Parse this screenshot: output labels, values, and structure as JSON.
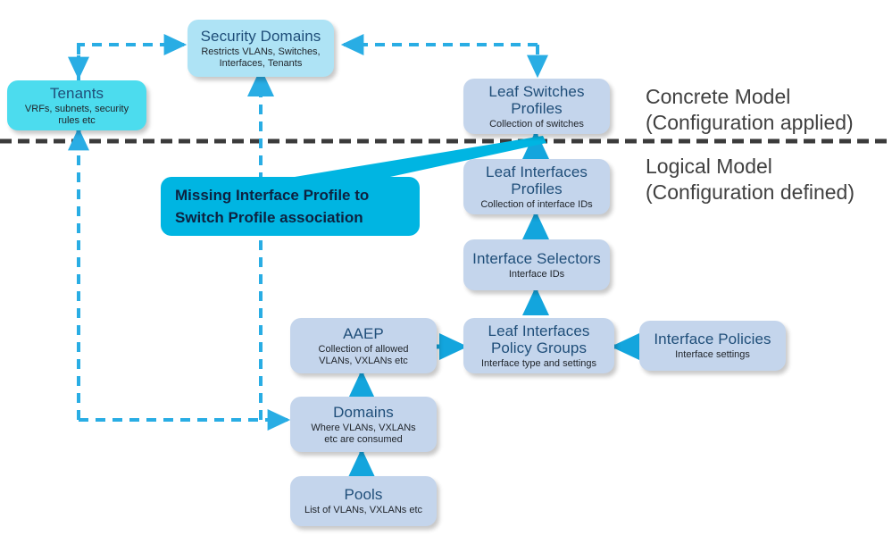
{
  "diagram": {
    "title_hidden": "ACI Policy Model Relationships",
    "colors": {
      "logical_box": "#c4d5ec",
      "concrete_box": "#aee3f5",
      "tenant_box": "#4cdcee",
      "callout": "#00b5e2",
      "arrow": "#29ade4",
      "divider": "#3b3b3b",
      "title_text": "#1f4e79",
      "side_label_text": "#404040"
    }
  },
  "nodes": {
    "security_domains": {
      "title": "Security Domains",
      "subtitle": "Restricts VLANs, Switches,\nInterfaces, Tenants"
    },
    "tenants": {
      "title": "Tenants",
      "subtitle": "VRFs, subnets, security\nrules etc"
    },
    "leaf_switches_profiles": {
      "title": "Leaf Switches\nProfiles",
      "subtitle": "Collection of switches"
    },
    "leaf_interfaces_profiles": {
      "title": "Leaf Interfaces\nProfiles",
      "subtitle": "Collection of interface IDs"
    },
    "interface_selectors": {
      "title": "Interface Selectors",
      "subtitle": "Interface IDs"
    },
    "leaf_interfaces_policy_groups": {
      "title": "Leaf Interfaces\nPolicy Groups",
      "subtitle": "Interface type and settings"
    },
    "interface_policies": {
      "title": "Interface Policies",
      "subtitle": "Interface settings"
    },
    "aaep": {
      "title": "AAEP",
      "subtitle": "Collection of allowed\nVLANs, VXLANs etc"
    },
    "domains": {
      "title": "Domains",
      "subtitle": "Where VLANs, VXLANs\netc are consumed"
    },
    "pools": {
      "title": "Pools",
      "subtitle": "List of VLANs, VXLANs etc"
    }
  },
  "callout": {
    "line1": "Missing Interface Profile to",
    "line2": "Switch Profile association"
  },
  "side_labels": {
    "concrete": "Concrete Model\n(Configuration applied)",
    "logical": "Logical Model\n(Configuration defined)"
  }
}
